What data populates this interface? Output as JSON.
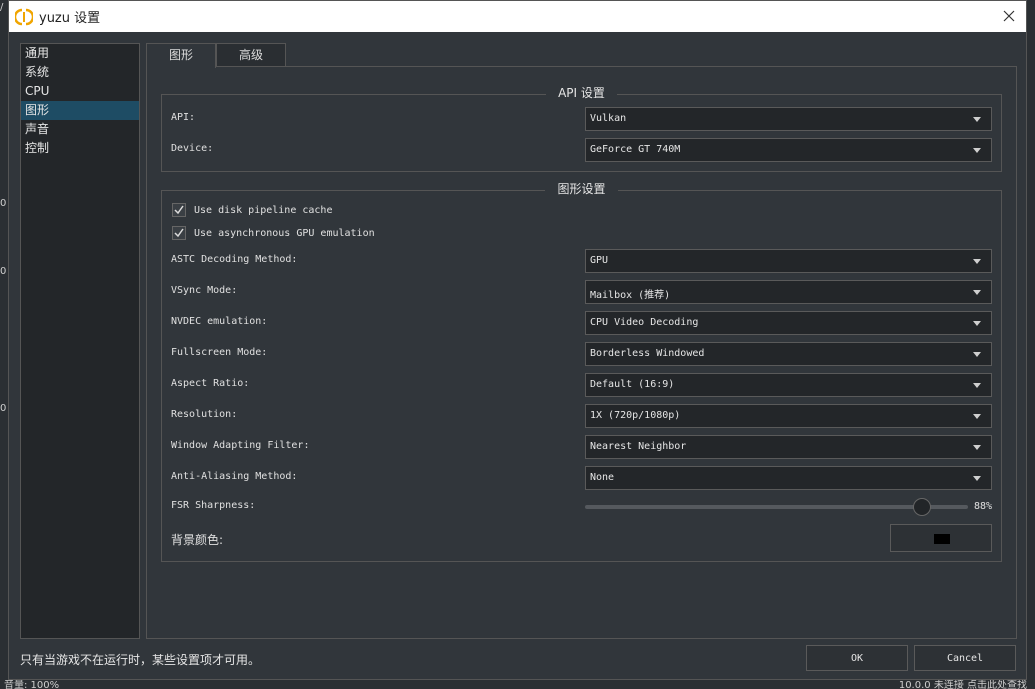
{
  "background": {
    "left_glyphs": [
      "/",
      "0",
      "0",
      "0"
    ],
    "bottom_left": "音量: 100%",
    "bottom_right": "10.0.0 未连接 点击此处查找"
  },
  "window": {
    "title": "yuzu 设置",
    "close_glyph": "✕"
  },
  "sidebar": {
    "items": [
      {
        "label": "通用"
      },
      {
        "label": "系统"
      },
      {
        "label": "CPU"
      },
      {
        "label": "图形"
      },
      {
        "label": "声音"
      },
      {
        "label": "控制"
      }
    ],
    "active_index": 3
  },
  "tabs": [
    {
      "label": "图形"
    },
    {
      "label": "高级"
    }
  ],
  "api_group": {
    "title": "API 设置",
    "api_label": "API:",
    "api_value": "Vulkan",
    "device_label": "Device:",
    "device_value": "GeForce GT 740M"
  },
  "graphics_group": {
    "title": "图形设置",
    "disk_cache_label": "Use disk pipeline cache",
    "disk_cache_checked": true,
    "async_gpu_label": "Use asynchronous GPU emulation",
    "async_gpu_checked": true,
    "astc_label": "ASTC Decoding Method:",
    "astc_value": "GPU",
    "vsync_label": "VSync Mode:",
    "vsync_value": "Mailbox (推荐)",
    "nvdec_label": "NVDEC emulation:",
    "nvdec_value": "CPU Video Decoding",
    "fullscreen_label": "Fullscreen Mode:",
    "fullscreen_value": "Borderless Windowed",
    "aspect_label": "Aspect Ratio:",
    "aspect_value": "Default (16:9)",
    "resolution_label": "Resolution:",
    "resolution_value": "1X (720p/1080p)",
    "filter_label": "Window Adapting Filter:",
    "filter_value": "Nearest Neighbor",
    "aa_label": "Anti-Aliasing Method:",
    "aa_value": "None",
    "fsr_label": "FSR Sharpness:",
    "fsr_value": "88%",
    "fsr_level": 0.88,
    "bg_color_label": "背景颜色:",
    "bg_color": "#000000"
  },
  "footer": {
    "note": "只有当游戏不在运行时，某些设置项才可用。",
    "ok_label": "OK",
    "cancel_label": "Cancel"
  },
  "colors": {
    "accent": "#1e4c64",
    "panel": "#31363b",
    "input": "#232629"
  }
}
